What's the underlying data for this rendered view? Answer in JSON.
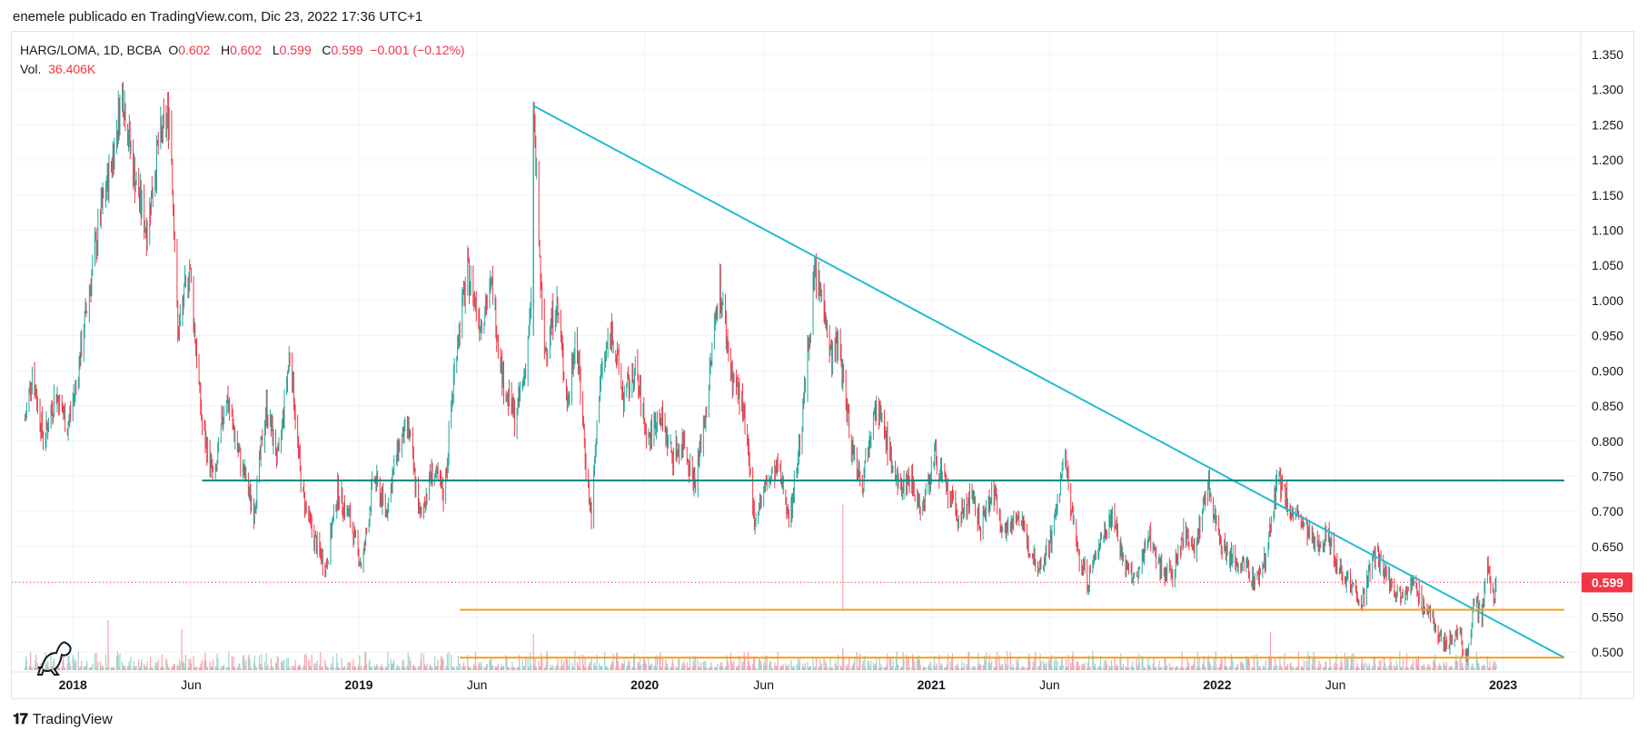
{
  "header": {
    "published": "enemele publicado en TradingView.com, Dic 23, 2022 17:36 UTC+1"
  },
  "legend": {
    "symbol": "HARG/LOMA, 1D, BCBA",
    "o_label": "O",
    "o_value": "0.602",
    "h_label": "H",
    "h_value": "0.602",
    "l_label": "L",
    "l_value": "0.599",
    "c_label": "C",
    "c_value": "0.599",
    "change": "−0.001 (−0.12%)",
    "vol_label": "Vol.",
    "vol_value": "36.406K"
  },
  "footer": {
    "brand": "TradingView"
  },
  "colors": {
    "up": "#26a69a",
    "down": "#f23645",
    "trendline": "#22bcd4",
    "resistance": "#00897b",
    "support": "#f59c1a",
    "last_price": "#f23645"
  },
  "chart_data": {
    "type": "candlestick",
    "symbol": "HARG/LOMA",
    "interval": "1D",
    "exchange": "BCBA",
    "ylim": [
      0.48,
      1.37
    ],
    "y_ticks": [
      "1.350",
      "1.300",
      "1.250",
      "1.200",
      "1.150",
      "1.100",
      "1.050",
      "1.000",
      "0.950",
      "0.900",
      "0.850",
      "0.800",
      "0.750",
      "0.700",
      "0.650",
      "0.600",
      "0.550",
      "0.500"
    ],
    "x_range": [
      "2017-10-15",
      "2023-04-10"
    ],
    "x_ticks": [
      {
        "date": "2018-01-01",
        "label": "2018"
      },
      {
        "date": "2018-06-01",
        "label": "Jun"
      },
      {
        "date": "2019-01-01",
        "label": "2019"
      },
      {
        "date": "2019-06-01",
        "label": "Jun"
      },
      {
        "date": "2020-01-01",
        "label": "2020"
      },
      {
        "date": "2020-06-01",
        "label": "Jun"
      },
      {
        "date": "2021-01-01",
        "label": "2021"
      },
      {
        "date": "2021-06-01",
        "label": "Jun"
      },
      {
        "date": "2022-01-01",
        "label": "2022"
      },
      {
        "date": "2022-06-01",
        "label": "Jun"
      },
      {
        "date": "2023-01-01",
        "label": "2023"
      }
    ],
    "price_path": [
      [
        "2017-11-01",
        0.83
      ],
      [
        "2017-11-10",
        0.9
      ],
      [
        "2017-11-25",
        0.8
      ],
      [
        "2017-12-10",
        0.87
      ],
      [
        "2017-12-25",
        0.82
      ],
      [
        "2018-01-05",
        0.88
      ],
      [
        "2018-01-20",
        1.0
      ],
      [
        "2018-02-05",
        1.12
      ],
      [
        "2018-02-20",
        1.2
      ],
      [
        "2018-03-05",
        1.3
      ],
      [
        "2018-03-20",
        1.18
      ],
      [
        "2018-04-05",
        1.1
      ],
      [
        "2018-04-20",
        1.22
      ],
      [
        "2018-05-05",
        1.27
      ],
      [
        "2018-05-15",
        0.95
      ],
      [
        "2018-05-30",
        1.05
      ],
      [
        "2018-06-15",
        0.82
      ],
      [
        "2018-07-01",
        0.74
      ],
      [
        "2018-07-15",
        0.87
      ],
      [
        "2018-08-01",
        0.78
      ],
      [
        "2018-08-20",
        0.7
      ],
      [
        "2018-09-05",
        0.85
      ],
      [
        "2018-09-20",
        0.77
      ],
      [
        "2018-10-05",
        0.93
      ],
      [
        "2018-10-20",
        0.73
      ],
      [
        "2018-11-05",
        0.66
      ],
      [
        "2018-11-20",
        0.62
      ],
      [
        "2018-12-05",
        0.73
      ],
      [
        "2018-12-20",
        0.69
      ],
      [
        "2019-01-05",
        0.62
      ],
      [
        "2019-01-20",
        0.75
      ],
      [
        "2019-02-05",
        0.7
      ],
      [
        "2019-02-20",
        0.79
      ],
      [
        "2019-03-05",
        0.82
      ],
      [
        "2019-03-20",
        0.69
      ],
      [
        "2019-04-05",
        0.76
      ],
      [
        "2019-04-20",
        0.72
      ],
      [
        "2019-05-05",
        0.93
      ],
      [
        "2019-05-20",
        1.04
      ],
      [
        "2019-06-05",
        0.97
      ],
      [
        "2019-06-20",
        1.02
      ],
      [
        "2019-07-05",
        0.88
      ],
      [
        "2019-07-20",
        0.83
      ],
      [
        "2019-08-01",
        0.9
      ],
      [
        "2019-08-09",
        0.99
      ],
      [
        "2019-08-12",
        1.28
      ],
      [
        "2019-08-15",
        1.19
      ],
      [
        "2019-08-25",
        0.92
      ],
      [
        "2019-09-10",
        1.0
      ],
      [
        "2019-09-25",
        0.85
      ],
      [
        "2019-10-05",
        0.96
      ],
      [
        "2019-10-20",
        0.74
      ],
      [
        "2019-10-25",
        0.69
      ],
      [
        "2019-11-05",
        0.89
      ],
      [
        "2019-11-20",
        0.96
      ],
      [
        "2019-12-05",
        0.86
      ],
      [
        "2019-12-20",
        0.9
      ],
      [
        "2020-01-05",
        0.8
      ],
      [
        "2020-01-20",
        0.84
      ],
      [
        "2020-02-05",
        0.78
      ],
      [
        "2020-02-20",
        0.8
      ],
      [
        "2020-03-05",
        0.74
      ],
      [
        "2020-03-20",
        0.85
      ],
      [
        "2020-04-05",
        1.03
      ],
      [
        "2020-04-20",
        0.9
      ],
      [
        "2020-05-05",
        0.85
      ],
      [
        "2020-05-20",
        0.69
      ],
      [
        "2020-06-05",
        0.74
      ],
      [
        "2020-06-20",
        0.76
      ],
      [
        "2020-07-05",
        0.69
      ],
      [
        "2020-07-20",
        0.83
      ],
      [
        "2020-08-05",
        1.04
      ],
      [
        "2020-08-20",
        0.98
      ],
      [
        "2020-08-25",
        0.92
      ],
      [
        "2020-09-05",
        0.94
      ],
      [
        "2020-09-20",
        0.8
      ],
      [
        "2020-10-05",
        0.74
      ],
      [
        "2020-10-20",
        0.86
      ],
      [
        "2020-11-05",
        0.8
      ],
      [
        "2020-11-20",
        0.73
      ],
      [
        "2020-12-05",
        0.75
      ],
      [
        "2020-12-20",
        0.7
      ],
      [
        "2021-01-05",
        0.78
      ],
      [
        "2021-01-20",
        0.73
      ],
      [
        "2021-02-05",
        0.69
      ],
      [
        "2021-02-20",
        0.72
      ],
      [
        "2021-03-05",
        0.68
      ],
      [
        "2021-03-20",
        0.73
      ],
      [
        "2021-04-05",
        0.67
      ],
      [
        "2021-04-20",
        0.7
      ],
      [
        "2021-05-05",
        0.65
      ],
      [
        "2021-05-20",
        0.62
      ],
      [
        "2021-06-05",
        0.67
      ],
      [
        "2021-06-20",
        0.78
      ],
      [
        "2021-07-05",
        0.65
      ],
      [
        "2021-07-20",
        0.6
      ],
      [
        "2021-08-05",
        0.66
      ],
      [
        "2021-08-20",
        0.7
      ],
      [
        "2021-09-05",
        0.62
      ],
      [
        "2021-09-20",
        0.6
      ],
      [
        "2021-10-05",
        0.67
      ],
      [
        "2021-10-20",
        0.62
      ],
      [
        "2021-11-05",
        0.61
      ],
      [
        "2021-11-20",
        0.67
      ],
      [
        "2021-12-05",
        0.65
      ],
      [
        "2021-12-20",
        0.74
      ],
      [
        "2022-01-05",
        0.66
      ],
      [
        "2022-01-20",
        0.63
      ],
      [
        "2022-02-05",
        0.62
      ],
      [
        "2022-02-20",
        0.6
      ],
      [
        "2022-03-05",
        0.64
      ],
      [
        "2022-03-20",
        0.75
      ],
      [
        "2022-04-05",
        0.7
      ],
      [
        "2022-04-20",
        0.68
      ],
      [
        "2022-05-05",
        0.65
      ],
      [
        "2022-05-20",
        0.67
      ],
      [
        "2022-06-05",
        0.62
      ],
      [
        "2022-06-20",
        0.6
      ],
      [
        "2022-07-05",
        0.57
      ],
      [
        "2022-07-20",
        0.64
      ],
      [
        "2022-08-05",
        0.61
      ],
      [
        "2022-08-20",
        0.58
      ],
      [
        "2022-09-05",
        0.6
      ],
      [
        "2022-09-20",
        0.57
      ],
      [
        "2022-10-05",
        0.54
      ],
      [
        "2022-10-20",
        0.51
      ],
      [
        "2022-11-05",
        0.53
      ],
      [
        "2022-11-15",
        0.49
      ],
      [
        "2022-11-25",
        0.57
      ],
      [
        "2022-12-05",
        0.55
      ],
      [
        "2022-12-12",
        0.62
      ],
      [
        "2022-12-20",
        0.58
      ],
      [
        "2022-12-23",
        0.599
      ]
    ],
    "spikes": [
      {
        "date": "2019-08-12",
        "high": 1.28
      },
      {
        "date": "2020-09-10",
        "high": 0.71,
        "low": 0.56
      }
    ],
    "drawings": [
      {
        "kind": "trendline",
        "from": [
          "2019-08-12",
          1.277
        ],
        "to": [
          "2023-03-20",
          0.492
        ]
      },
      {
        "kind": "horizontal",
        "label": "resistance",
        "from": "2018-06-15",
        "to": "2023-03-20",
        "y": 0.744
      },
      {
        "kind": "horizontal",
        "label": "support",
        "from": "2019-05-10",
        "to": "2023-03-20",
        "y": 0.56
      },
      {
        "kind": "horizontal",
        "label": "support",
        "from": "2019-05-10",
        "to": "2023-03-20",
        "y": 0.492
      }
    ],
    "last_price": {
      "value": 0.599,
      "label": "0.599"
    },
    "volume_note": "volume histogram at bottom, last 36.406K"
  }
}
